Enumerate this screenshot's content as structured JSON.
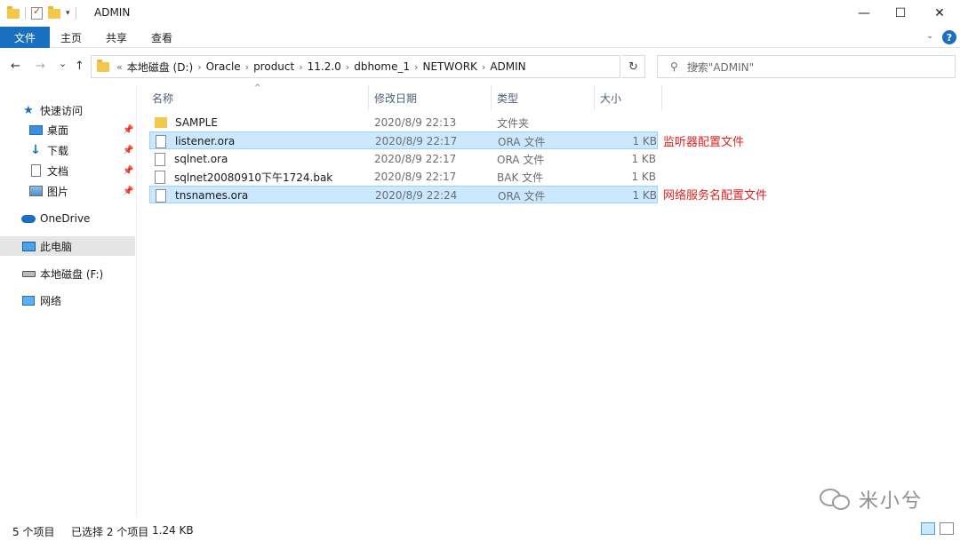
{
  "window": {
    "title": "ADMIN",
    "controls": {
      "minimize": "—",
      "maximize": "☐",
      "close": "✕"
    }
  },
  "ribbon": {
    "tabs": [
      "文件",
      "主页",
      "共享",
      "查看"
    ],
    "help": "?"
  },
  "nav": {
    "back": "←",
    "forward": "→",
    "recent": "⌄",
    "up": "↑",
    "breadcrumb": [
      "«",
      "本地磁盘 (D:)",
      "Oracle",
      "product",
      "11.2.0",
      "dbhome_1",
      "NETWORK",
      "ADMIN"
    ],
    "search_placeholder": "搜索\"ADMIN\""
  },
  "sidebar": {
    "items": [
      {
        "label": "快速访问",
        "icon": "star-icon"
      },
      {
        "label": "桌面",
        "icon": "desktop-icon",
        "pinned": true
      },
      {
        "label": "下载",
        "icon": "download-icon",
        "pinned": true
      },
      {
        "label": "文档",
        "icon": "documents-icon",
        "pinned": true
      },
      {
        "label": "图片",
        "icon": "pictures-icon",
        "pinned": true
      },
      {
        "label": "OneDrive",
        "icon": "onedrive-icon"
      },
      {
        "label": "此电脑",
        "icon": "this-pc-icon",
        "selected": true
      },
      {
        "label": "本地磁盘 (F:)",
        "icon": "drive-icon"
      },
      {
        "label": "网络",
        "icon": "network-icon"
      }
    ]
  },
  "columns": [
    "名称",
    "修改日期",
    "类型",
    "大小"
  ],
  "files": [
    {
      "name": "SAMPLE",
      "date": "2020/8/9 22:13",
      "type": "文件夹",
      "size": "",
      "selected": false,
      "kind": "folder",
      "note": ""
    },
    {
      "name": "listener.ora",
      "date": "2020/8/9 22:17",
      "type": "ORA 文件",
      "size": "1 KB",
      "selected": true,
      "kind": "file",
      "note": "监听器配置文件"
    },
    {
      "name": "sqlnet.ora",
      "date": "2020/8/9 22:17",
      "type": "ORA 文件",
      "size": "1 KB",
      "selected": false,
      "kind": "file",
      "note": ""
    },
    {
      "name": "sqlnet20080910下午1724.bak",
      "date": "2020/8/9 22:17",
      "type": "BAK 文件",
      "size": "1 KB",
      "selected": false,
      "kind": "file",
      "note": ""
    },
    {
      "name": "tnsnames.ora",
      "date": "2020/8/9 22:24",
      "type": "ORA 文件",
      "size": "1 KB",
      "selected": true,
      "kind": "file",
      "note": "网络服务名配置文件"
    }
  ],
  "status": {
    "count": "5 个项目",
    "selection": "已选择 2 个项目",
    "size": "1.24 KB"
  },
  "watermark": "米小兮",
  "colors": {
    "accent": "#1a6fc1",
    "selection": "#cce8ff",
    "annotation": "#e02020"
  }
}
